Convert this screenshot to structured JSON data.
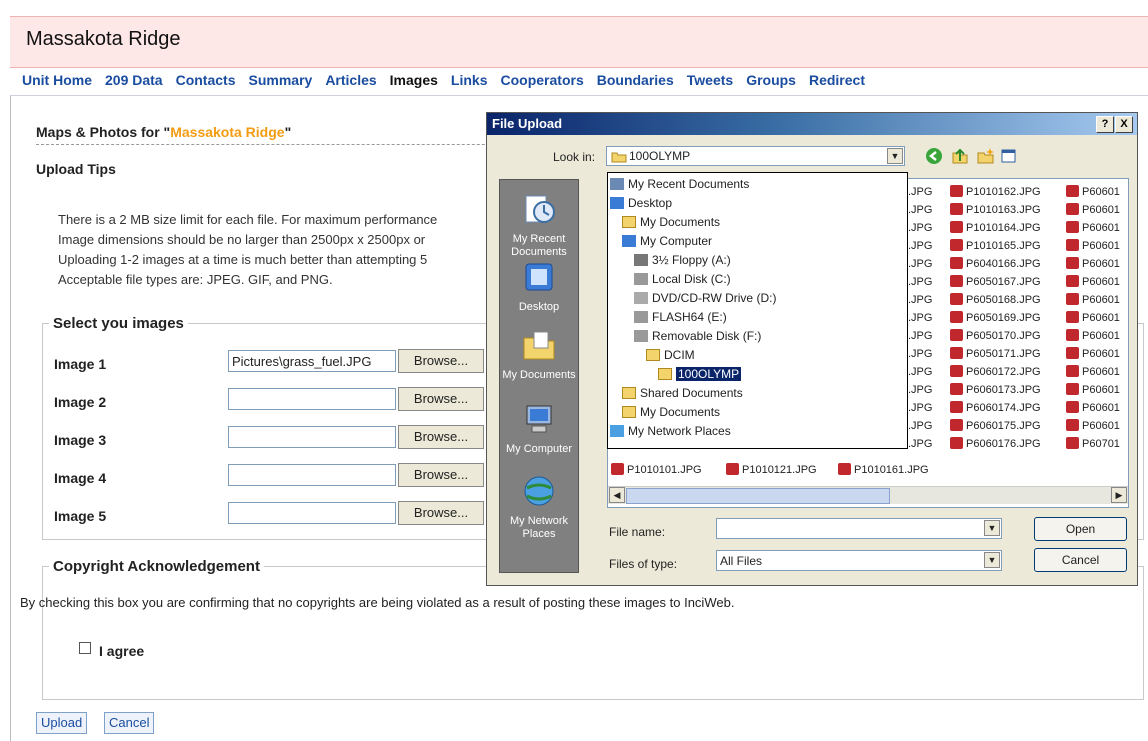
{
  "site": {
    "title": "Massakota Ridge",
    "nav": [
      {
        "label": "Unit Home"
      },
      {
        "label": "209 Data"
      },
      {
        "label": "Contacts"
      },
      {
        "label": "Summary"
      },
      {
        "label": "Articles"
      },
      {
        "label": "Images",
        "active": true
      },
      {
        "label": "Links"
      },
      {
        "label": "Cooperators"
      },
      {
        "label": "Boundaries"
      },
      {
        "label": "Tweets"
      },
      {
        "label": "Groups"
      },
      {
        "label": "Redirect"
      }
    ]
  },
  "page": {
    "maps_title_prefix": "Maps & Photos for \"",
    "maps_title_name": "Massakota Ridge",
    "maps_title_suffix": "\"",
    "upload_tips_heading": "Upload Tips",
    "tips": [
      "There is a 2 MB size limit for each file. For maximum performance",
      "Image dimensions should be no larger than 2500px x 2500px or",
      "Uploading 1-2 images at a time is much better than attempting 5",
      "Acceptable file types are: JPEG. GIF, and PNG."
    ],
    "select_legend": "Select you images",
    "images": [
      {
        "label": "Image 1",
        "value": "Pictures\\grass_fuel.JPG",
        "browse": "Browse..."
      },
      {
        "label": "Image 2",
        "value": "",
        "browse": "Browse..."
      },
      {
        "label": "Image 3",
        "value": "",
        "browse": "Browse..."
      },
      {
        "label": "Image 4",
        "value": "",
        "browse": "Browse..."
      },
      {
        "label": "Image 5",
        "value": "",
        "browse": "Browse..."
      }
    ],
    "copyright_legend": "Copyright Acknowledgement",
    "copyright_text": "By checking this box you are confirming that no copyrights are being violated as a result of posting these images to InciWeb.",
    "agree_label": "I agree",
    "upload_button": "Upload",
    "cancel_button": "Cancel"
  },
  "dialog": {
    "title": "File Upload",
    "help_btn": "?",
    "close_btn": "X",
    "look_in_label": "Look in:",
    "look_in_value": "100OLYMP",
    "places": [
      {
        "label": "My Recent Documents",
        "icon": "recent-documents-icon"
      },
      {
        "label": "Desktop",
        "icon": "desktop-icon"
      },
      {
        "label": "My Documents",
        "icon": "my-documents-icon"
      },
      {
        "label": "My Computer",
        "icon": "my-computer-icon"
      },
      {
        "label": "My Network Places",
        "icon": "network-places-icon"
      }
    ],
    "dropdown_items": [
      {
        "label": "My Recent Documents",
        "icon": "recent"
      },
      {
        "label": "Desktop",
        "icon": "desktop"
      },
      {
        "label": "My Documents",
        "icon": "folder"
      },
      {
        "label": "My Computer",
        "icon": "computer"
      },
      {
        "label": "3½ Floppy (A:)",
        "icon": "floppy"
      },
      {
        "label": "Local Disk (C:)",
        "icon": "drive"
      },
      {
        "label": "DVD/CD-RW Drive (D:)",
        "icon": "cd"
      },
      {
        "label": "FLASH64 (E:)",
        "icon": "drive"
      },
      {
        "label": "Removable Disk (F:)",
        "icon": "drive"
      },
      {
        "label": "DCIM",
        "icon": "folder"
      },
      {
        "label": "100OLYMP",
        "icon": "folder",
        "selected": true
      },
      {
        "label": "Shared Documents",
        "icon": "folder"
      },
      {
        "label": "My Documents",
        "icon": "folder"
      },
      {
        "label": "My Network Places",
        "icon": "network"
      }
    ],
    "file_col2": [
      ".JPG",
      ".JPG",
      ".JPG",
      ".JPG",
      ".JPG",
      ".JPG",
      ".JPG",
      ".JPG",
      ".JPG",
      ".JPG",
      ".JPG",
      ".JPG",
      ".JPG",
      ".JPG",
      ".JPG"
    ],
    "file_col3": [
      "P1010162.JPG",
      "P1010163.JPG",
      "P1010164.JPG",
      "P1010165.JPG",
      "P6040166.JPG",
      "P6050167.JPG",
      "P6050168.JPG",
      "P6050169.JPG",
      "P6050170.JPG",
      "P6050171.JPG",
      "P6060172.JPG",
      "P6060173.JPG",
      "P6060174.JPG",
      "P6060175.JPG",
      "P6060176.JPG"
    ],
    "file_col4": [
      "P60601",
      "P60601",
      "P60601",
      "P60601",
      "P60601",
      "P60601",
      "P60601",
      "P60601",
      "P60601",
      "P60601",
      "P60601",
      "P60601",
      "P60601",
      "P60601",
      "P60701"
    ],
    "bottom_row": [
      "P1010101.JPG",
      "P1010121.JPG",
      "P1010161.JPG"
    ],
    "file_name_label": "File name:",
    "file_name_value": "",
    "files_of_type_label": "Files of type:",
    "files_of_type_value": "All Files",
    "open_button": "Open",
    "cancel_button": "Cancel"
  },
  "colors": {
    "header_bg": "#fde7e7",
    "nav_link": "#1a4da0",
    "highlight": "#f39c12",
    "dialog_titlebar": "#0a246a"
  }
}
